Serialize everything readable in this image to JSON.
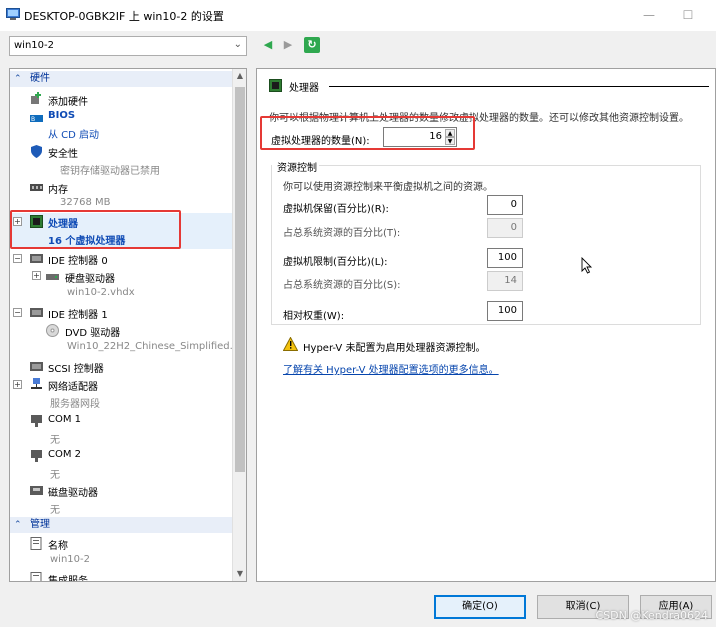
{
  "window": {
    "title": "DESKTOP-0GBK2IF 上 win10-2 的设置",
    "minimize": "—",
    "maximize": "☐"
  },
  "toolbar": {
    "vm_selected": "win10-2",
    "back": "◀",
    "forward": "▶",
    "refresh": "↻"
  },
  "sidebar": {
    "hardware_header": "硬件",
    "management_header": "管理",
    "items": [
      {
        "label": "添加硬件",
        "sub": ""
      },
      {
        "label": "BIOS",
        "sub": "从 CD 启动"
      },
      {
        "label": "安全性",
        "sub": "密钥存储驱动器已禁用"
      },
      {
        "label": "内存",
        "sub": "32768 MB"
      },
      {
        "label": "处理器",
        "sub": "16 个虚拟处理器"
      },
      {
        "label": "IDE 控制器 0",
        "sub": ""
      },
      {
        "label": "硬盘驱动器",
        "sub": "win10-2.vhdx"
      },
      {
        "label": "IDE 控制器 1",
        "sub": ""
      },
      {
        "label": "DVD 驱动器",
        "sub": "Win10_22H2_Chinese_Simplified..."
      },
      {
        "label": "SCSI 控制器",
        "sub": ""
      },
      {
        "label": "网络适配器",
        "sub": "服务器网段"
      },
      {
        "label": "COM 1",
        "sub": "无"
      },
      {
        "label": "COM 2",
        "sub": "无"
      },
      {
        "label": "磁盘驱动器",
        "sub": "无"
      }
    ],
    "mgmt_items": [
      {
        "label": "名称",
        "sub": "win10-2"
      },
      {
        "label": "集成服务",
        "sub": ""
      }
    ]
  },
  "processor": {
    "section_title": "处理器",
    "description": "你可以根据物理计算机上处理器的数量修改虚拟处理器的数量。还可以修改其他资源控制设置。",
    "count_label": "虚拟处理器的数量(N):",
    "count_value": "16",
    "resource_group": "资源控制",
    "resource_desc": "你可以使用资源控制来平衡虚拟机之间的资源。",
    "reserve_label": "虚拟机保留(百分比)(R):",
    "reserve_value": "0",
    "reserve_total_label": "占总系统资源的百分比(T):",
    "reserve_total_value": "0",
    "limit_label": "虚拟机限制(百分比)(L):",
    "limit_value": "100",
    "limit_total_label": "占总系统资源的百分比(S):",
    "limit_total_value": "14",
    "weight_label": "相对权重(W):",
    "weight_value": "100",
    "warning": "Hyper-V 未配置为启用处理器资源控制。",
    "link": "了解有关 Hyper-V 处理器配置选项的更多信息。"
  },
  "buttons": {
    "ok": "确定(O)",
    "cancel": "取消(C)",
    "apply": "应用(A)"
  },
  "watermark": "CSDN @Kendra0624",
  "colors": {
    "accent": "#0078d7",
    "highlight_box": "#e53935",
    "link": "#0645ad"
  }
}
